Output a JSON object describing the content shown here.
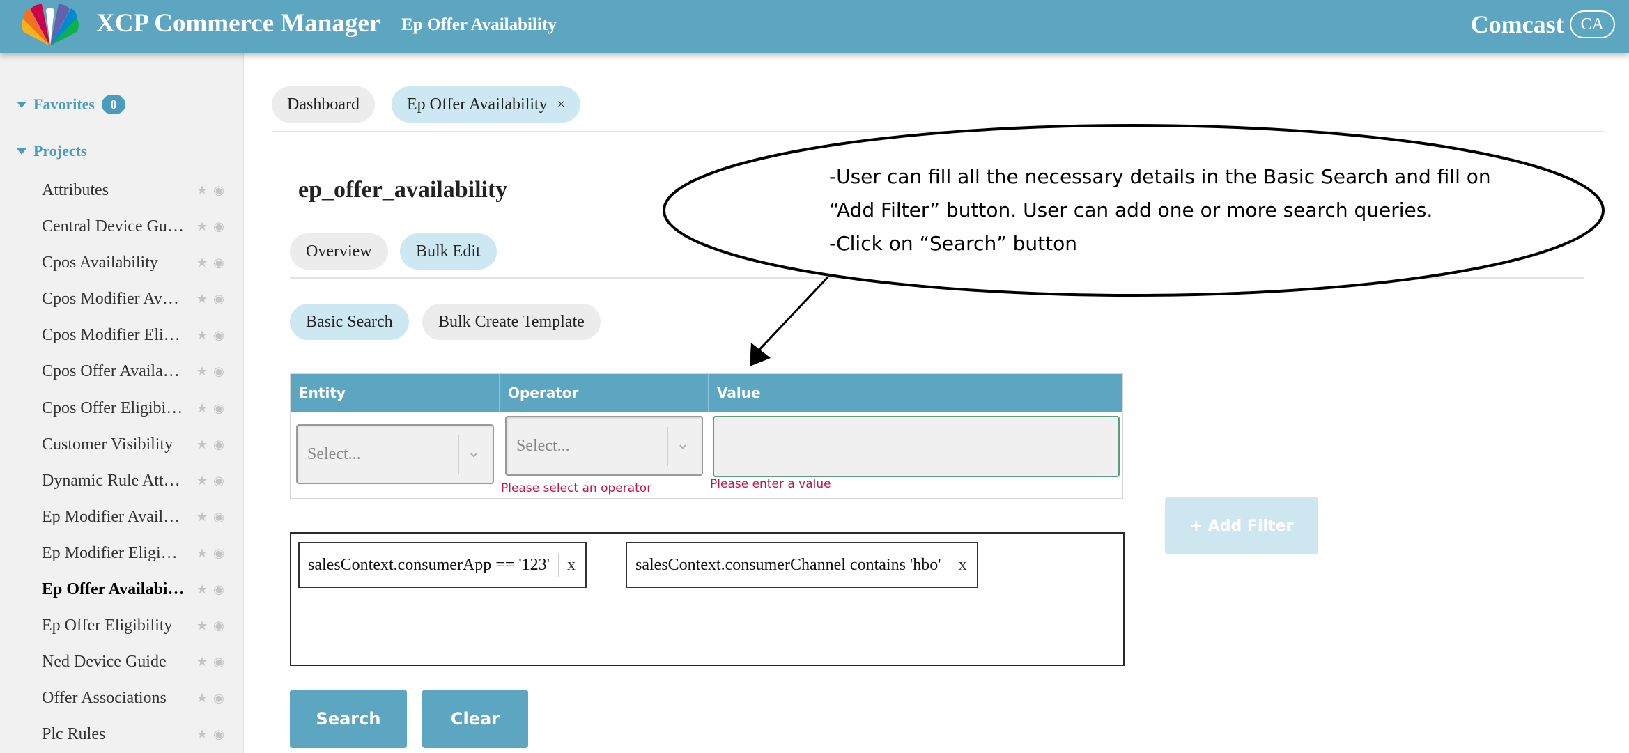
{
  "header": {
    "app_title": "XCP Commerce Manager",
    "page_subtitle": "Ep Offer Availability",
    "brand": "Comcast",
    "brand_badge": "CA",
    "logo_icon": "peacock-logo-icon",
    "colors": {
      "header_bg": "#5da6c2",
      "accent": "#4a9cbd"
    }
  },
  "sidebar": {
    "favorites": {
      "label": "Favorites",
      "count": "0"
    },
    "projects": {
      "label": "Projects"
    },
    "items": [
      {
        "label": "Attributes"
      },
      {
        "label": "Central Device Guide"
      },
      {
        "label": "Cpos Availability"
      },
      {
        "label": "Cpos Modifier Availability"
      },
      {
        "label": "Cpos Modifier Eligibility"
      },
      {
        "label": "Cpos Offer Availability"
      },
      {
        "label": "Cpos Offer Eligibility"
      },
      {
        "label": "Customer Visibility"
      },
      {
        "label": "Dynamic Rule Attributes"
      },
      {
        "label": "Ep Modifier Availability"
      },
      {
        "label": "Ep Modifier Eligibility"
      },
      {
        "label": "Ep Offer Availability",
        "active": true
      },
      {
        "label": "Ep Offer Eligibility"
      },
      {
        "label": "Ned Device Guide"
      },
      {
        "label": "Offer Associations"
      },
      {
        "label": "Plc Rules"
      }
    ]
  },
  "tabs": {
    "dashboard": "Dashboard",
    "current": "Ep Offer Availability",
    "close": "×"
  },
  "main": {
    "title": "ep_offer_availability",
    "subtabs": {
      "overview": "Overview",
      "bulk_edit": "Bulk Edit"
    },
    "modes": {
      "basic_search": "Basic Search",
      "bulk_template": "Bulk Create Template"
    },
    "filter_table": {
      "headers": {
        "entity": "Entity",
        "operator": "Operator",
        "value": "Value"
      },
      "entity_placeholder": "Select...",
      "operator_placeholder": "Select...",
      "value": "",
      "operator_error": "Please select an operator",
      "value_error": "Please enter a value"
    },
    "add_filter": "+ Add Filter",
    "queries": [
      {
        "text": "salesContext.consumerApp == '123'",
        "remove": "x"
      },
      {
        "text": "salesContext.consumerChannel contains 'hbo'",
        "remove": "x"
      }
    ],
    "search_button": "Search",
    "clear_button": "Clear"
  },
  "annotation": {
    "lines": [
      "-User can fill all the necessary details in the Basic Search and fill on",
      "“Add Filter” button. User can add one or more search queries.",
      "-Click on “Search” button"
    ]
  }
}
